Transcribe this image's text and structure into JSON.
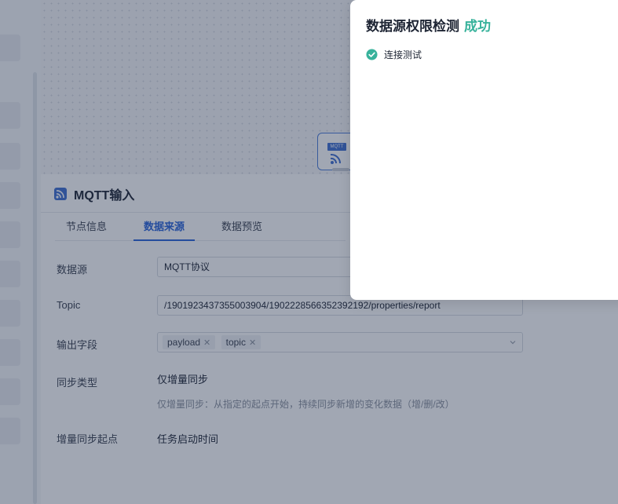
{
  "node": {
    "badge": "MQTT"
  },
  "panel": {
    "title": "MQTT输入",
    "tabs": [
      {
        "label": "节点信息",
        "active": false
      },
      {
        "label": "数据来源",
        "active": true
      },
      {
        "label": "数据预览",
        "active": false
      }
    ],
    "form": {
      "datasource": {
        "label": "数据源",
        "value": "MQTT协议"
      },
      "topic": {
        "label": "Topic",
        "value": "/1901923437355003904/1902228566352392192/properties/report"
      },
      "output_fields": {
        "label": "输出字段",
        "tags": [
          "payload",
          "topic"
        ],
        "remove_symbol": "✕"
      },
      "sync_type": {
        "label": "同步类型",
        "value": "仅增量同步",
        "hint": "仅增量同步：从指定的起点开始，持续同步新增的变化数据（增/删/改）"
      },
      "sync_start": {
        "label": "增量同步起点",
        "value": "任务启动时间"
      }
    }
  },
  "dialog": {
    "title": "数据源权限检测",
    "status": "成功",
    "status_color": "#37b29b",
    "checks": [
      {
        "label": "连接测试",
        "icon": "check-circle-icon"
      }
    ]
  },
  "colors": {
    "accent": "#2962d9",
    "success": "#37b29b"
  }
}
